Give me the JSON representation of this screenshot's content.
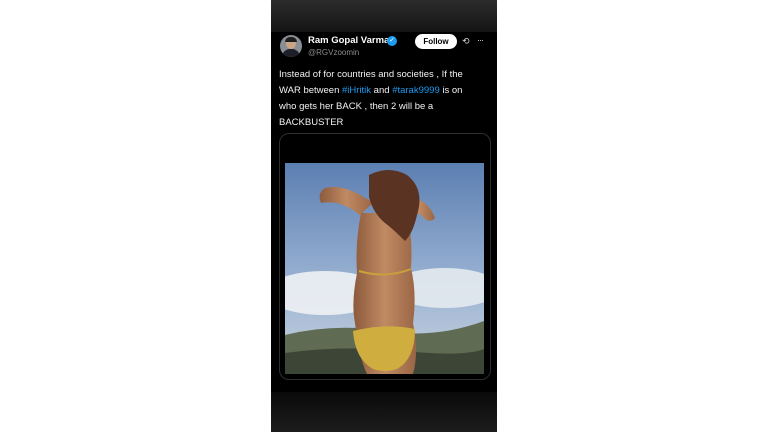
{
  "tweet": {
    "author_name": "Ram Gopal Varma",
    "handle": "@RGVzoomin",
    "follow_label": "Follow",
    "text_lines": [
      [
        "Instead of for countries and societies , If the"
      ],
      [
        "WAR between ",
        "#iHritik",
        " and ",
        "#tarak9999",
        " is on"
      ],
      [
        "who gets her BACK  , then 2 will be a"
      ],
      [
        "BACKBUSTER"
      ]
    ],
    "hashtags": [
      "#iHritik",
      "#tarak9999"
    ]
  },
  "icons": {
    "verified": "verified-badge-icon",
    "grok": "grok-icon",
    "more": "more-options-icon"
  },
  "colors": {
    "background": "#000000",
    "hashtag": "#1d9bf0",
    "verified": "#1d9bf0",
    "handle": "#8b8b8b"
  }
}
